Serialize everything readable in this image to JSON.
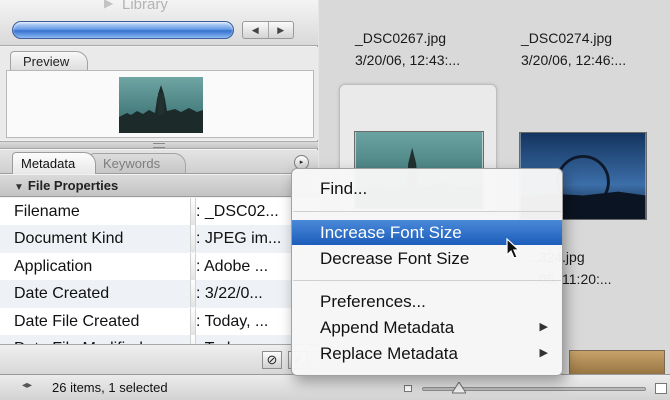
{
  "library": {
    "label": "Library",
    "nav_back": "◀",
    "nav_forward": "▶"
  },
  "preview": {
    "tab_label": "Preview"
  },
  "metadata_panel": {
    "tabs": [
      {
        "label": "Metadata",
        "active": true
      },
      {
        "label": "Keywords",
        "active": false
      }
    ],
    "panel_menu_icon": "▸",
    "section_title": "File Properties",
    "rows": [
      {
        "label": "Filename",
        "value": ": _DSC02..."
      },
      {
        "label": "Document Kind",
        "value": ": JPEG im..."
      },
      {
        "label": "Application",
        "value": ": Adobe ..."
      },
      {
        "label": "Date Created",
        "value": ": 3/22/0..."
      },
      {
        "label": "Date File Created",
        "value": ": Today, ..."
      },
      {
        "label": "Date File Modified",
        "value": ": Tod..."
      }
    ],
    "footer_buttons": {
      "no": "⊘",
      "check": "✓"
    }
  },
  "files": [
    {
      "name": "_DSC0267.jpg",
      "date": "3/20/06, 12:43:..."
    },
    {
      "name": "_DSC0274.jpg",
      "date": "3/20/06, 12:46:..."
    },
    {
      "name": "...324.jpg",
      "date": "...05, 11:20:..."
    }
  ],
  "context_menu": {
    "items": [
      {
        "label": "Find...",
        "highlighted": false,
        "submenu": false
      },
      {
        "label": "Increase Font Size",
        "highlighted": true,
        "submenu": false
      },
      {
        "label": "Decrease Font Size",
        "highlighted": false,
        "submenu": false
      },
      {
        "label": "Preferences...",
        "highlighted": false,
        "submenu": false
      },
      {
        "label": "Append Metadata",
        "highlighted": false,
        "submenu": true
      },
      {
        "label": "Replace Metadata",
        "highlighted": false,
        "submenu": true
      }
    ],
    "submenu_arrow": "▶"
  },
  "status": {
    "text": "26 items, 1 selected",
    "arrows": "◂▸"
  },
  "colors": {
    "highlight": "#2a6cc9",
    "sky_teal": "#3e7d7e",
    "night_blue": "#1f4f8d"
  }
}
